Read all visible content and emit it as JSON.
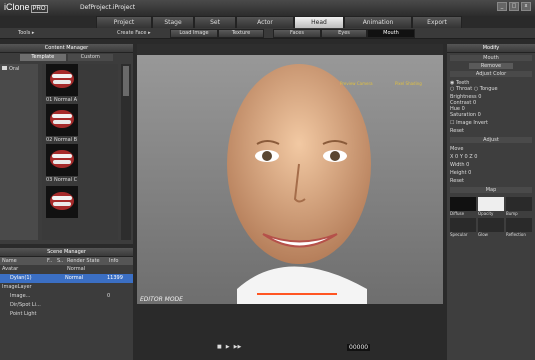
{
  "app": {
    "logo": "iClone",
    "edition": "PRO",
    "project": "DefProject.iProject"
  },
  "window_controls": [
    "_",
    "□",
    "x"
  ],
  "top_tabs": [
    "Project",
    "Stage",
    "Set",
    "Actor",
    "Head",
    "Animation",
    "Export"
  ],
  "active_tab": "Head",
  "toolrow": {
    "tools_label": "Tools ▸",
    "create_face_label": "Create Face ▸",
    "buttons": [
      "Load Image",
      "Texture",
      "Faces",
      "Eyes",
      "Mouth"
    ],
    "active_button": "Mouth"
  },
  "content_manager": {
    "title": "Content Manager",
    "tabs": [
      "Template",
      "Custom"
    ],
    "tree_root": "Oral",
    "thumbnails": [
      "01 Normal A",
      "02 Normal B",
      "03 Normal C",
      ""
    ]
  },
  "scene_manager": {
    "title": "Scene Manager",
    "columns": [
      "Name",
      "F..",
      "S..",
      "Render State",
      "Info"
    ],
    "rows": [
      {
        "name": "Avatar",
        "render": "Normal",
        "info": ""
      },
      {
        "name": "Dylan(1)",
        "render": "Normal",
        "info": "11399"
      },
      {
        "name": "ImageLayer",
        "render": "",
        "info": ""
      },
      {
        "name": "Image...",
        "render": "",
        "info": "0"
      },
      {
        "name": "Dir/Spot Li...",
        "render": "",
        "info": ""
      },
      {
        "name": "Point Light",
        "render": "",
        "info": ""
      }
    ]
  },
  "viewport": {
    "preview_label": "Preview Camera",
    "shading_label": "Pixel Shading",
    "mode_label": "EDITOR MODE"
  },
  "playback": {
    "timecode": "00000"
  },
  "modify": {
    "title": "Modify",
    "section": "Mouth",
    "remove_label": "Remove",
    "adjust_color_label": "Adjust Color",
    "radios": [
      "Teeth",
      "Throat",
      "Tongue"
    ],
    "selected_radio": "Teeth",
    "sliders": [
      {
        "label": "Brightness",
        "value": "0"
      },
      {
        "label": "Contrast",
        "value": "0"
      },
      {
        "label": "Hue",
        "value": "0"
      },
      {
        "label": "Saturation",
        "value": "0"
      }
    ],
    "image_invert_label": "Image Invert",
    "reset_label": "Reset",
    "adjust_label": "Adjust",
    "move_label": "Move",
    "move_axes": [
      "X",
      "Y",
      "Z"
    ],
    "move_values": [
      "0",
      "0",
      "0"
    ],
    "width_label": "Width",
    "width_value": "0",
    "height_label": "Height",
    "height_value": "0",
    "reset2_label": "Reset",
    "map_label": "Map",
    "maps": [
      "Diffuse",
      "Opacity",
      "Bump",
      "Specular",
      "Glow",
      "Reflection"
    ]
  },
  "colors": {
    "accent": "#e0c040",
    "active_tab": "#e9e9e9",
    "panel": "#3c3c3c",
    "selection": "#3b6fc4"
  }
}
